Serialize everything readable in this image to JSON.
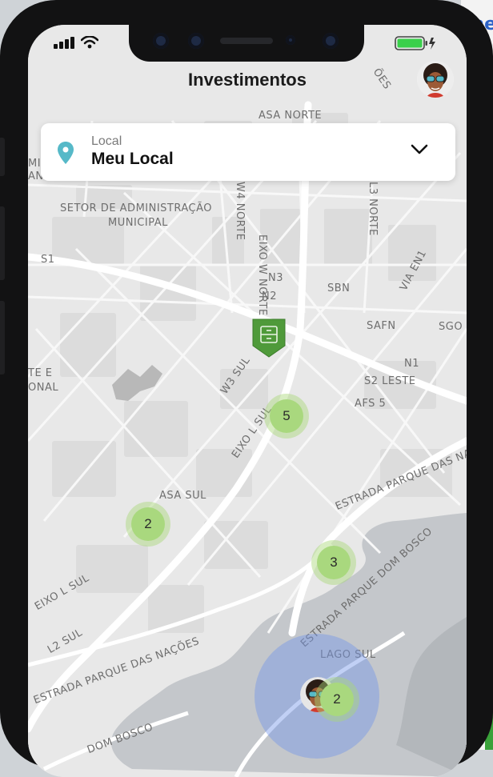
{
  "background": {
    "right_text": "lhe"
  },
  "header": {
    "title": "Investimentos"
  },
  "location": {
    "label": "Local",
    "value": "Meu Local"
  },
  "map": {
    "labels": [
      "ASA NORTE",
      "SETOR DE ADMINISTRAÇÃO",
      "MUNICIPAL",
      "ASA SUL",
      "LAGO SUL",
      "EIXO W NORTE",
      "W4 NORTE",
      "L3 NORTE",
      "VIA EN1",
      "SBN",
      "SAFN",
      "SGO",
      "N1",
      "N2",
      "N3",
      "S1",
      "S2 LESTE",
      "AFS 5",
      "W3 SUL",
      "EIXO L SUL",
      "L2 SUL",
      "ESTRADA PARQUE DAS NAÇÕES",
      "ESTRADA PARQUE DOM BOSCO",
      "ESTRADA PARQUE DAS NAÇÕES",
      "DOM BOSCO",
      "TE E",
      "ONAL",
      "MI",
      "AN",
      "EIXO L SUL",
      "ÕES"
    ]
  },
  "clusters": [
    {
      "count": "5"
    },
    {
      "count": "2"
    },
    {
      "count": "3"
    },
    {
      "count": "2"
    }
  ],
  "icons": {
    "signal": "cellular-signal-icon",
    "wifi": "wifi-icon",
    "battery": "battery-charging-icon",
    "pin": "location-pin-icon",
    "chevron": "chevron-down-icon",
    "marker": "investment-marker-icon"
  },
  "colors": {
    "cluster": "#a9d87e",
    "marker": "#4f9a3a",
    "pin": "#56b9c8",
    "user_area": "#7696e8",
    "battery": "#3ad04b"
  }
}
